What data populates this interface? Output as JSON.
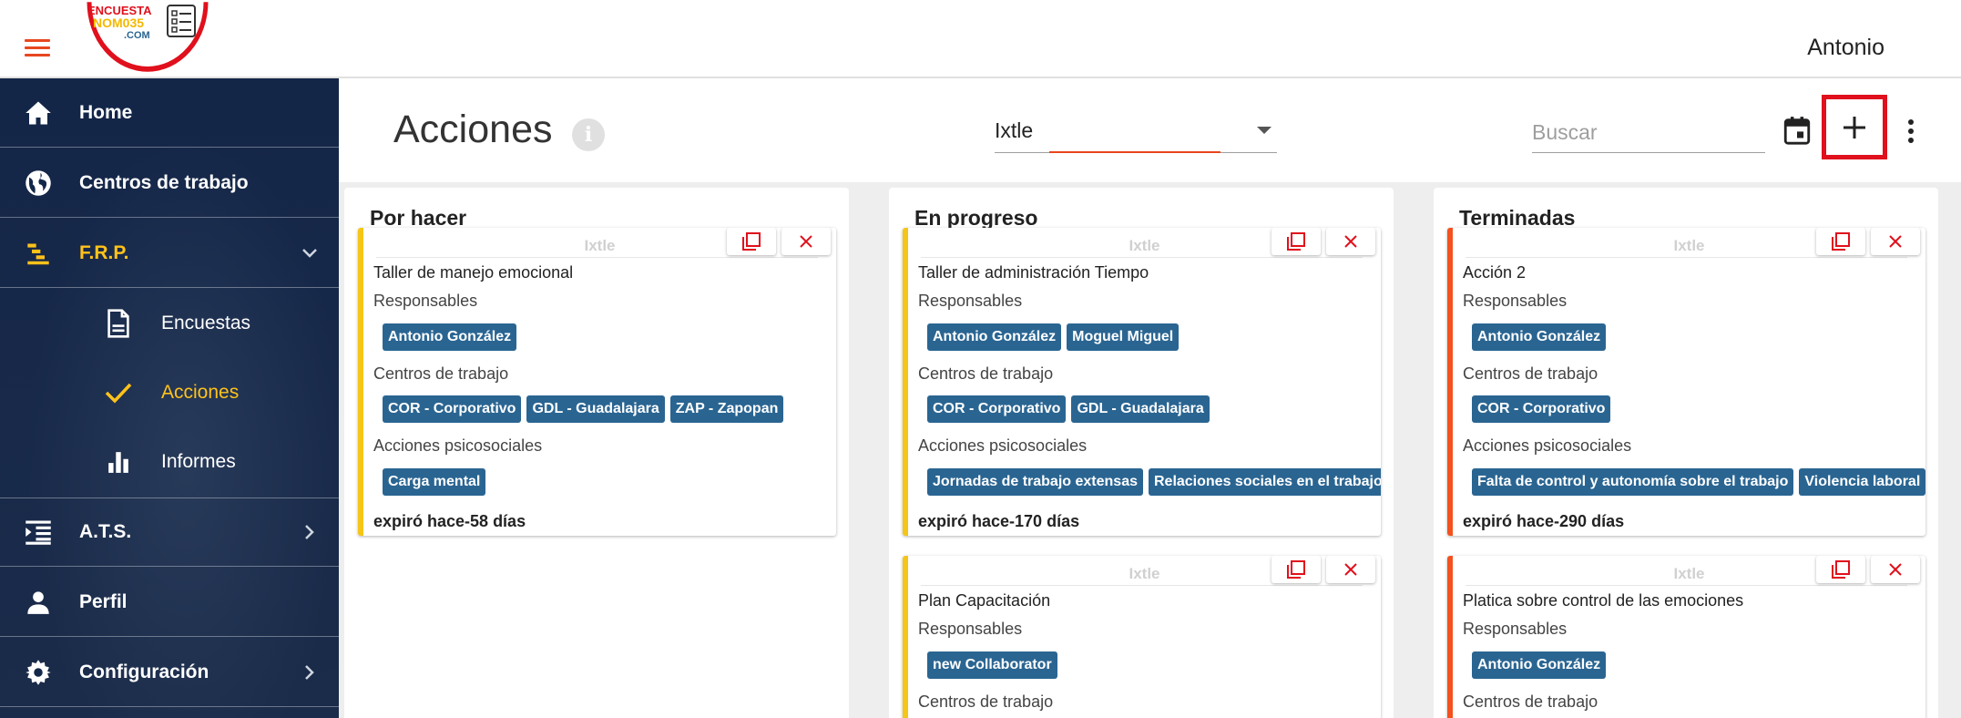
{
  "topbar": {
    "logo_text_1": "ENCUESTA",
    "logo_text_2": "NOM035",
    "logo_text_3": ".COM",
    "user_name": "Antonio"
  },
  "sidebar": {
    "items": [
      {
        "label": "Home",
        "icon": "home-icon"
      },
      {
        "label": "Centros de trabajo",
        "icon": "globe-icon"
      },
      {
        "label": "F.R.P.",
        "icon": "frp-list-icon"
      },
      {
        "label": "Encuestas",
        "icon": "document-icon"
      },
      {
        "label": "Acciones",
        "icon": "check-icon"
      },
      {
        "label": "Informes",
        "icon": "bar-chart-icon"
      },
      {
        "label": "A.T.S.",
        "icon": "list-indent-icon"
      },
      {
        "label": "Perfil",
        "icon": "person-icon"
      },
      {
        "label": "Configuración",
        "icon": "gear-icon"
      }
    ],
    "active_color": "#ffc21a"
  },
  "header": {
    "title": "Acciones",
    "info_symbol": "i",
    "centro_select_value": "Ixtle",
    "search_placeholder": "Buscar"
  },
  "columns": [
    {
      "title": "Por hacer",
      "bar_color": "#f5c518",
      "cards": [
        {
          "centro": "Ixtle",
          "name": "Taller de manejo emocional",
          "responsables_label": "Responsables",
          "responsables": [
            "Antonio González"
          ],
          "centros_label": "Centros de trabajo",
          "centros": [
            "COR - Corporativo",
            "GDL - Guadalajara",
            "ZAP - Zapopan"
          ],
          "acciones_label": "Acciones psicosociales",
          "acciones": [
            "Carga mental"
          ],
          "due": "expiró hace-58 días"
        }
      ]
    },
    {
      "title": "En progreso",
      "bar_color": "#f5c518",
      "cards": [
        {
          "centro": "Ixtle",
          "name": "Taller de administración Tiempo",
          "responsables_label": "Responsables",
          "responsables": [
            "Antonio González",
            "Moguel Miguel"
          ],
          "centros_label": "Centros de trabajo",
          "centros": [
            "COR - Corporativo",
            "GDL - Guadalajara"
          ],
          "acciones_label": "Acciones psicosociales",
          "acciones": [
            "Jornadas de trabajo extensas",
            "Relaciones sociales en el trabajo"
          ],
          "due": "expiró hace-170 días"
        },
        {
          "centro": "Ixtle",
          "name": "Plan Capacitación",
          "responsables_label": "Responsables",
          "responsables": [
            "new Collaborator"
          ],
          "centros_label": "Centros de trabajo"
        }
      ]
    },
    {
      "title": "Terminadas",
      "bar_color": "#f4511e",
      "cards": [
        {
          "centro": "Ixtle",
          "name": "Acción 2",
          "responsables_label": "Responsables",
          "responsables": [
            "Antonio González"
          ],
          "centros_label": "Centros de trabajo",
          "centros": [
            "COR - Corporativo"
          ],
          "acciones_label": "Acciones psicosociales",
          "acciones": [
            "Falta de control y autonomía sobre el trabajo",
            "Violencia laboral"
          ],
          "due": "expiró hace-290 días"
        },
        {
          "centro": "Ixtle",
          "name": "Platica sobre control de las emociones",
          "responsables_label": "Responsables",
          "responsables": [
            "Antonio González"
          ],
          "centros_label": "Centros de trabajo"
        }
      ]
    }
  ],
  "colors": {
    "chip": "#2a6592",
    "accent": "#e8471f",
    "delete": "#e0101c",
    "sidebar_bg": "#13274a"
  }
}
